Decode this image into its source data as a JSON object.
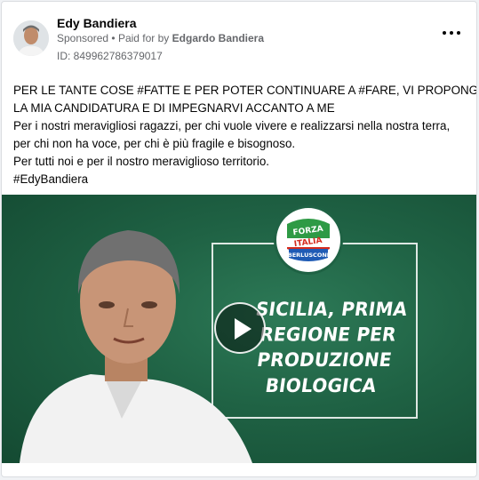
{
  "post": {
    "author": "Edy Bandiera",
    "sponsored": "Sponsored",
    "paid_prefix": "Paid for by",
    "paid_by": "Edgardo Bandiera",
    "ad_id": "ID: 849962786379017",
    "more_icon": "more-options-icon"
  },
  "body_lines": [
    "PER LE TANTE COSE #FATTE E PER POTER CONTINUARE A #FARE, VI PROPONGO",
    "LA MIA CANDIDATURA E DI IMPEGNARVI ACCANTO A ME",
    "Per i nostri meravigliosi ragazzi, per chi vuole vivere e realizzarsi nella nostra terra,",
    "per chi non ha voce, per chi è più fragile e bisognoso.",
    "Per tutti noi e per il nostro meraviglioso territorio.",
    "#EdyBandiera"
  ],
  "video": {
    "logo_top": "FORZA",
    "logo_mid": "ITALIA",
    "logo_bottom": "BERLUSCONI",
    "headline": [
      "SICILIA, PRIMA",
      "REGIONE PER",
      "PRODUZIONE",
      "BIOLOGICA"
    ],
    "play_icon": "play-icon",
    "colors": {
      "background": "#1f6244",
      "logo_blue": "#1f5bb5",
      "logo_red": "#d52b1e",
      "logo_green": "#2e9a45"
    }
  }
}
